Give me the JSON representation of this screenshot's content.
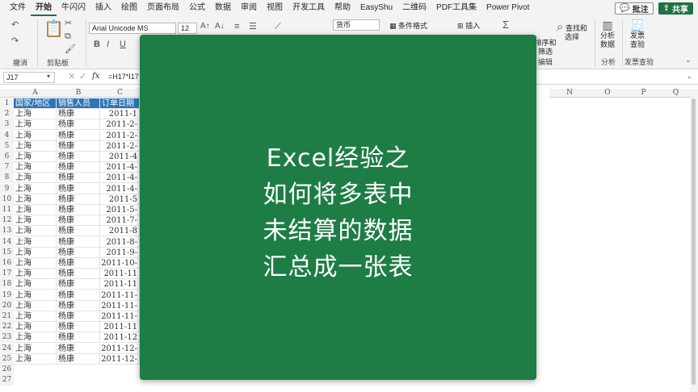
{
  "menu": {
    "tabs": [
      "文件",
      "开始",
      "牛闪闪",
      "插入",
      "绘图",
      "页面布局",
      "公式",
      "数据",
      "审阅",
      "视图",
      "开发工具",
      "帮助",
      "EasyShu",
      "二维码",
      "PDF工具集",
      "Power Pivot"
    ],
    "active_tab": "开始",
    "comment_label": "批注",
    "share_label": "共享"
  },
  "ribbon": {
    "undo_label": "撤消",
    "clipboard_label": "剪贴板",
    "font_name": "Arial Unicode MS",
    "font_size": "12",
    "number_format": "货币",
    "conditional_format_label": "条件格式",
    "insert_label": "插入",
    "sort_filter_label": "排序和筛选",
    "find_select_label": "查找和选择",
    "editing_label": "编辑",
    "analyze_data_label": "分析数据",
    "analysis_label": "分析",
    "invoice_check_label": "发票查验",
    "invoice_group_label": "发票查验"
  },
  "formula_bar": {
    "name_box": "J17",
    "fx_label": "fx",
    "formula": "=H17*I17"
  },
  "grid": {
    "columns": [
      "A",
      "B",
      "C",
      "N",
      "O",
      "P",
      "Q"
    ],
    "header_row": [
      "国家/地区",
      "销售人员",
      "订单日期"
    ],
    "rows": [
      [
        "上海",
        "杨康",
        "2011-1"
      ],
      [
        "上海",
        "杨康",
        "2011-2-"
      ],
      [
        "上海",
        "杨康",
        "2011-2-"
      ],
      [
        "上海",
        "杨康",
        "2011-2-"
      ],
      [
        "上海",
        "杨康",
        "2011-4"
      ],
      [
        "上海",
        "杨康",
        "2011-4-"
      ],
      [
        "上海",
        "杨康",
        "2011-4-"
      ],
      [
        "上海",
        "杨康",
        "2011-4-"
      ],
      [
        "上海",
        "杨康",
        "2011-5"
      ],
      [
        "上海",
        "杨康",
        "2011-5-"
      ],
      [
        "上海",
        "杨康",
        "2011-7-"
      ],
      [
        "上海",
        "杨康",
        "2011-8"
      ],
      [
        "上海",
        "杨康",
        "2011-8-"
      ],
      [
        "上海",
        "杨康",
        "2011-9-"
      ],
      [
        "上海",
        "杨康",
        "2011-10-"
      ],
      [
        "上海",
        "杨康",
        "2011-11"
      ],
      [
        "上海",
        "杨康",
        "2011-11"
      ],
      [
        "上海",
        "杨康",
        "2011-11-"
      ],
      [
        "上海",
        "杨康",
        "2011-11-"
      ],
      [
        "上海",
        "杨康",
        "2011-11-"
      ],
      [
        "上海",
        "杨康",
        "2011-11"
      ],
      [
        "上海",
        "杨康",
        "2011-12"
      ],
      [
        "上海",
        "杨康",
        "2011-12-"
      ],
      [
        "上海",
        "杨康",
        "2011-12-"
      ]
    ],
    "row_numbers": [
      "1",
      "2",
      "3",
      "4",
      "5",
      "6",
      "7",
      "8",
      "9",
      "10",
      "11",
      "12",
      "13",
      "14",
      "15",
      "16",
      "17",
      "18",
      "19",
      "20",
      "21",
      "22",
      "23",
      "24",
      "25",
      "26",
      "27"
    ]
  },
  "overlay": {
    "lines": [
      "Excel经验之",
      "如何将多表中",
      "未结算的数据",
      "汇总成一张表"
    ],
    "background": "#1e7d45"
  },
  "colors": {
    "accent": "#1e7145",
    "header_fill": "#2f75b5"
  }
}
